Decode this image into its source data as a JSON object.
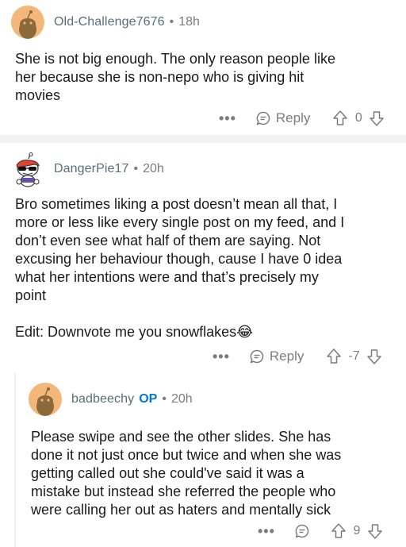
{
  "comments": [
    {
      "username": "Old-Challenge7676",
      "time": "18h",
      "body": "She is not big enough. The only reason people like\nher because she is non-nepo who is giving hit\nmovies",
      "reply_label": "Reply",
      "score": "0"
    },
    {
      "username": "DangerPie17",
      "time": "20h",
      "body": "Bro sometimes liking a post doesn’t mean all that, I\nmore or less like every single post on my feed, and I\ndon’t even see what half of them are saying. Not\nexcusing her behaviour though, cause I have 0 idea\nwhat her intentions were and that’s precisely my\npoint\n\nEdit: Downvote me you snowflakes😂",
      "reply_label": "Reply",
      "score": "-7"
    },
    {
      "username": "badbeechy",
      "op_badge": "OP",
      "time": "20h",
      "body": "Please swipe and see the other slides. She has\ndone it not just once but twice and when she was\ngetting called out she could've said it was a\nmistake but instead she referred the people who\nwere calling her out as haters and mentally sick",
      "score": "9"
    }
  ],
  "separator": "•",
  "more_glyph": "•••",
  "colors": {
    "username": "#576f76",
    "meta": "#7c7c7c",
    "op": "#0079d3",
    "avatar": "#f3b77a",
    "divider": "#f2f2f2"
  }
}
